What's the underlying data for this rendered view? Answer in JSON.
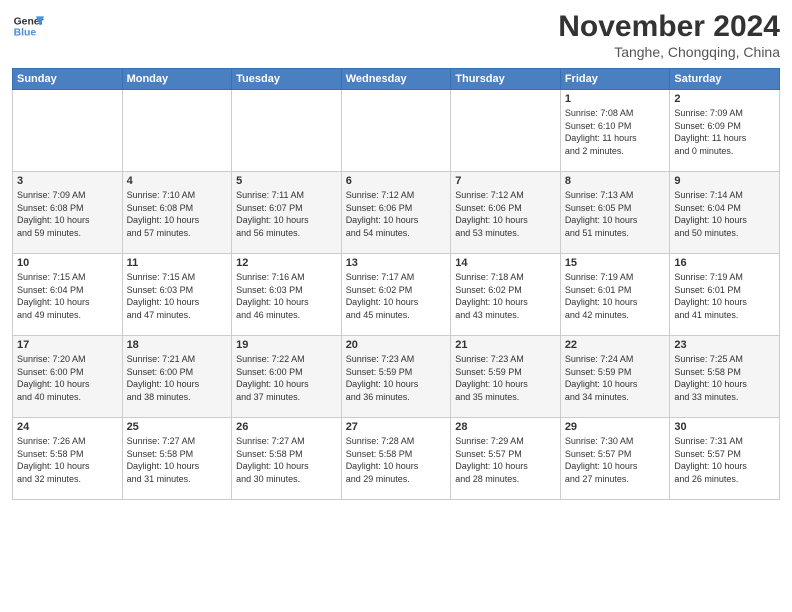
{
  "header": {
    "logo_line1": "General",
    "logo_line2": "Blue",
    "month": "November 2024",
    "location": "Tanghe, Chongqing, China"
  },
  "days_of_week": [
    "Sunday",
    "Monday",
    "Tuesday",
    "Wednesday",
    "Thursday",
    "Friday",
    "Saturday"
  ],
  "weeks": [
    [
      {
        "day": "",
        "info": ""
      },
      {
        "day": "",
        "info": ""
      },
      {
        "day": "",
        "info": ""
      },
      {
        "day": "",
        "info": ""
      },
      {
        "day": "",
        "info": ""
      },
      {
        "day": "1",
        "info": "Sunrise: 7:08 AM\nSunset: 6:10 PM\nDaylight: 11 hours\nand 2 minutes."
      },
      {
        "day": "2",
        "info": "Sunrise: 7:09 AM\nSunset: 6:09 PM\nDaylight: 11 hours\nand 0 minutes."
      }
    ],
    [
      {
        "day": "3",
        "info": "Sunrise: 7:09 AM\nSunset: 6:08 PM\nDaylight: 10 hours\nand 59 minutes."
      },
      {
        "day": "4",
        "info": "Sunrise: 7:10 AM\nSunset: 6:08 PM\nDaylight: 10 hours\nand 57 minutes."
      },
      {
        "day": "5",
        "info": "Sunrise: 7:11 AM\nSunset: 6:07 PM\nDaylight: 10 hours\nand 56 minutes."
      },
      {
        "day": "6",
        "info": "Sunrise: 7:12 AM\nSunset: 6:06 PM\nDaylight: 10 hours\nand 54 minutes."
      },
      {
        "day": "7",
        "info": "Sunrise: 7:12 AM\nSunset: 6:06 PM\nDaylight: 10 hours\nand 53 minutes."
      },
      {
        "day": "8",
        "info": "Sunrise: 7:13 AM\nSunset: 6:05 PM\nDaylight: 10 hours\nand 51 minutes."
      },
      {
        "day": "9",
        "info": "Sunrise: 7:14 AM\nSunset: 6:04 PM\nDaylight: 10 hours\nand 50 minutes."
      }
    ],
    [
      {
        "day": "10",
        "info": "Sunrise: 7:15 AM\nSunset: 6:04 PM\nDaylight: 10 hours\nand 49 minutes."
      },
      {
        "day": "11",
        "info": "Sunrise: 7:15 AM\nSunset: 6:03 PM\nDaylight: 10 hours\nand 47 minutes."
      },
      {
        "day": "12",
        "info": "Sunrise: 7:16 AM\nSunset: 6:03 PM\nDaylight: 10 hours\nand 46 minutes."
      },
      {
        "day": "13",
        "info": "Sunrise: 7:17 AM\nSunset: 6:02 PM\nDaylight: 10 hours\nand 45 minutes."
      },
      {
        "day": "14",
        "info": "Sunrise: 7:18 AM\nSunset: 6:02 PM\nDaylight: 10 hours\nand 43 minutes."
      },
      {
        "day": "15",
        "info": "Sunrise: 7:19 AM\nSunset: 6:01 PM\nDaylight: 10 hours\nand 42 minutes."
      },
      {
        "day": "16",
        "info": "Sunrise: 7:19 AM\nSunset: 6:01 PM\nDaylight: 10 hours\nand 41 minutes."
      }
    ],
    [
      {
        "day": "17",
        "info": "Sunrise: 7:20 AM\nSunset: 6:00 PM\nDaylight: 10 hours\nand 40 minutes."
      },
      {
        "day": "18",
        "info": "Sunrise: 7:21 AM\nSunset: 6:00 PM\nDaylight: 10 hours\nand 38 minutes."
      },
      {
        "day": "19",
        "info": "Sunrise: 7:22 AM\nSunset: 6:00 PM\nDaylight: 10 hours\nand 37 minutes."
      },
      {
        "day": "20",
        "info": "Sunrise: 7:23 AM\nSunset: 5:59 PM\nDaylight: 10 hours\nand 36 minutes."
      },
      {
        "day": "21",
        "info": "Sunrise: 7:23 AM\nSunset: 5:59 PM\nDaylight: 10 hours\nand 35 minutes."
      },
      {
        "day": "22",
        "info": "Sunrise: 7:24 AM\nSunset: 5:59 PM\nDaylight: 10 hours\nand 34 minutes."
      },
      {
        "day": "23",
        "info": "Sunrise: 7:25 AM\nSunset: 5:58 PM\nDaylight: 10 hours\nand 33 minutes."
      }
    ],
    [
      {
        "day": "24",
        "info": "Sunrise: 7:26 AM\nSunset: 5:58 PM\nDaylight: 10 hours\nand 32 minutes."
      },
      {
        "day": "25",
        "info": "Sunrise: 7:27 AM\nSunset: 5:58 PM\nDaylight: 10 hours\nand 31 minutes."
      },
      {
        "day": "26",
        "info": "Sunrise: 7:27 AM\nSunset: 5:58 PM\nDaylight: 10 hours\nand 30 minutes."
      },
      {
        "day": "27",
        "info": "Sunrise: 7:28 AM\nSunset: 5:58 PM\nDaylight: 10 hours\nand 29 minutes."
      },
      {
        "day": "28",
        "info": "Sunrise: 7:29 AM\nSunset: 5:57 PM\nDaylight: 10 hours\nand 28 minutes."
      },
      {
        "day": "29",
        "info": "Sunrise: 7:30 AM\nSunset: 5:57 PM\nDaylight: 10 hours\nand 27 minutes."
      },
      {
        "day": "30",
        "info": "Sunrise: 7:31 AM\nSunset: 5:57 PM\nDaylight: 10 hours\nand 26 minutes."
      }
    ]
  ]
}
